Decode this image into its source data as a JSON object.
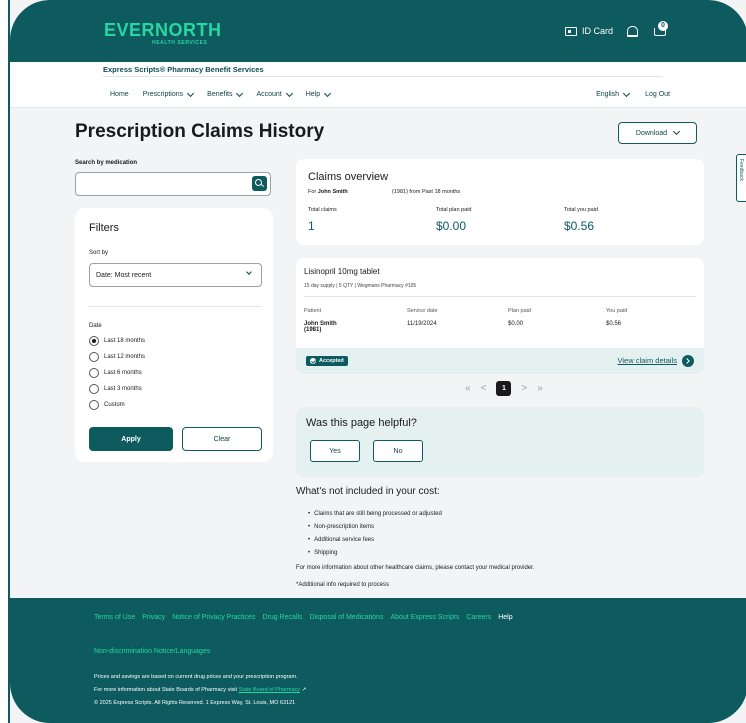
{
  "header": {
    "logo": "EVERNORTH",
    "logo_sub": "HEALTH SERVICES",
    "id_card": "ID Card",
    "cart_count": "0",
    "brand_line": "Express Scripts® Pharmacy Benefit Services"
  },
  "nav": {
    "home": "Home",
    "prescriptions": "Prescriptions",
    "benefits": "Benefits",
    "account": "Account",
    "help": "Help",
    "language": "English",
    "logout": "Log Out"
  },
  "page": {
    "title": "Prescription Claims History",
    "download": "Download",
    "feedback": "Feedback"
  },
  "search": {
    "label": "Search by medication",
    "placeholder": ""
  },
  "filters": {
    "title": "Filters",
    "sort_label": "Sort by",
    "sort_value": "Date: Most recent",
    "date_label": "Date",
    "options": [
      "Last 18 months",
      "Last 12 months",
      "Last 6 months",
      "Last 3 months",
      "Custom"
    ],
    "selected": "Last 18 months",
    "apply": "Apply",
    "clear": "Clear"
  },
  "overview": {
    "title": "Claims overview",
    "for_prefix": "For",
    "member": "John Smith",
    "range": "(1981) from Past 18 months",
    "total_claims_label": "Total claims",
    "total_claims": "1",
    "plan_paid_label": "Total plan paid",
    "plan_paid": "$0.00",
    "you_paid_label": "Total you paid",
    "you_paid": "$0.56"
  },
  "claim": {
    "drug": "Lisinopril 10mg tablet",
    "details": "15 day supply | 5 QTY | Wegmans Pharmacy #105",
    "patient_label": "Patient",
    "patient": "John Smith",
    "patient_year": "(1981)",
    "service_label": "Service date",
    "service_date": "11/19/2024",
    "plan_label": "Plan paid",
    "plan_paid": "$0.00",
    "you_label": "You paid",
    "you_paid": "$0.56",
    "status": "Accepted",
    "view_link": "View claim details"
  },
  "pager": {
    "first": "«",
    "prev": "<",
    "current": "1",
    "next": ">",
    "last": "»"
  },
  "helpful": {
    "question": "Was this page helpful?",
    "yes": "Yes",
    "no": "No"
  },
  "not_included": {
    "title": "What's not included in your cost:",
    "items": [
      "Claims that are still being processed or adjusted",
      "Non-prescription items",
      "Additional service fees",
      "Shipping"
    ],
    "more_info": "For more information about other healthcare claims, please contact your medical provider.",
    "additional": "*Additional info required to process"
  },
  "footer": {
    "links": [
      "Terms of Use",
      "Privacy",
      "Notice of Privacy Practices",
      "Drug Recalls",
      "Disposal of Medications",
      "About Express Scripts",
      "Careers",
      "Help"
    ],
    "nondiscrimination": "Non-discrimination Notice/Languages",
    "line1": "Prices and savings are based on current drug prices and your prescription program.",
    "line2_prefix": "For more information about State Boards of Pharmacy visit",
    "line2_link": "State Board of Pharmacy",
    "line3": "© 2025 Express Scripts. All Rights Reserved. 1 Express Way, St. Louis, MO 63121"
  },
  "colors": {
    "brand_teal": "#0d5b5f",
    "accent_green": "#27d6a1",
    "panel_tint": "#e5f0f1"
  }
}
